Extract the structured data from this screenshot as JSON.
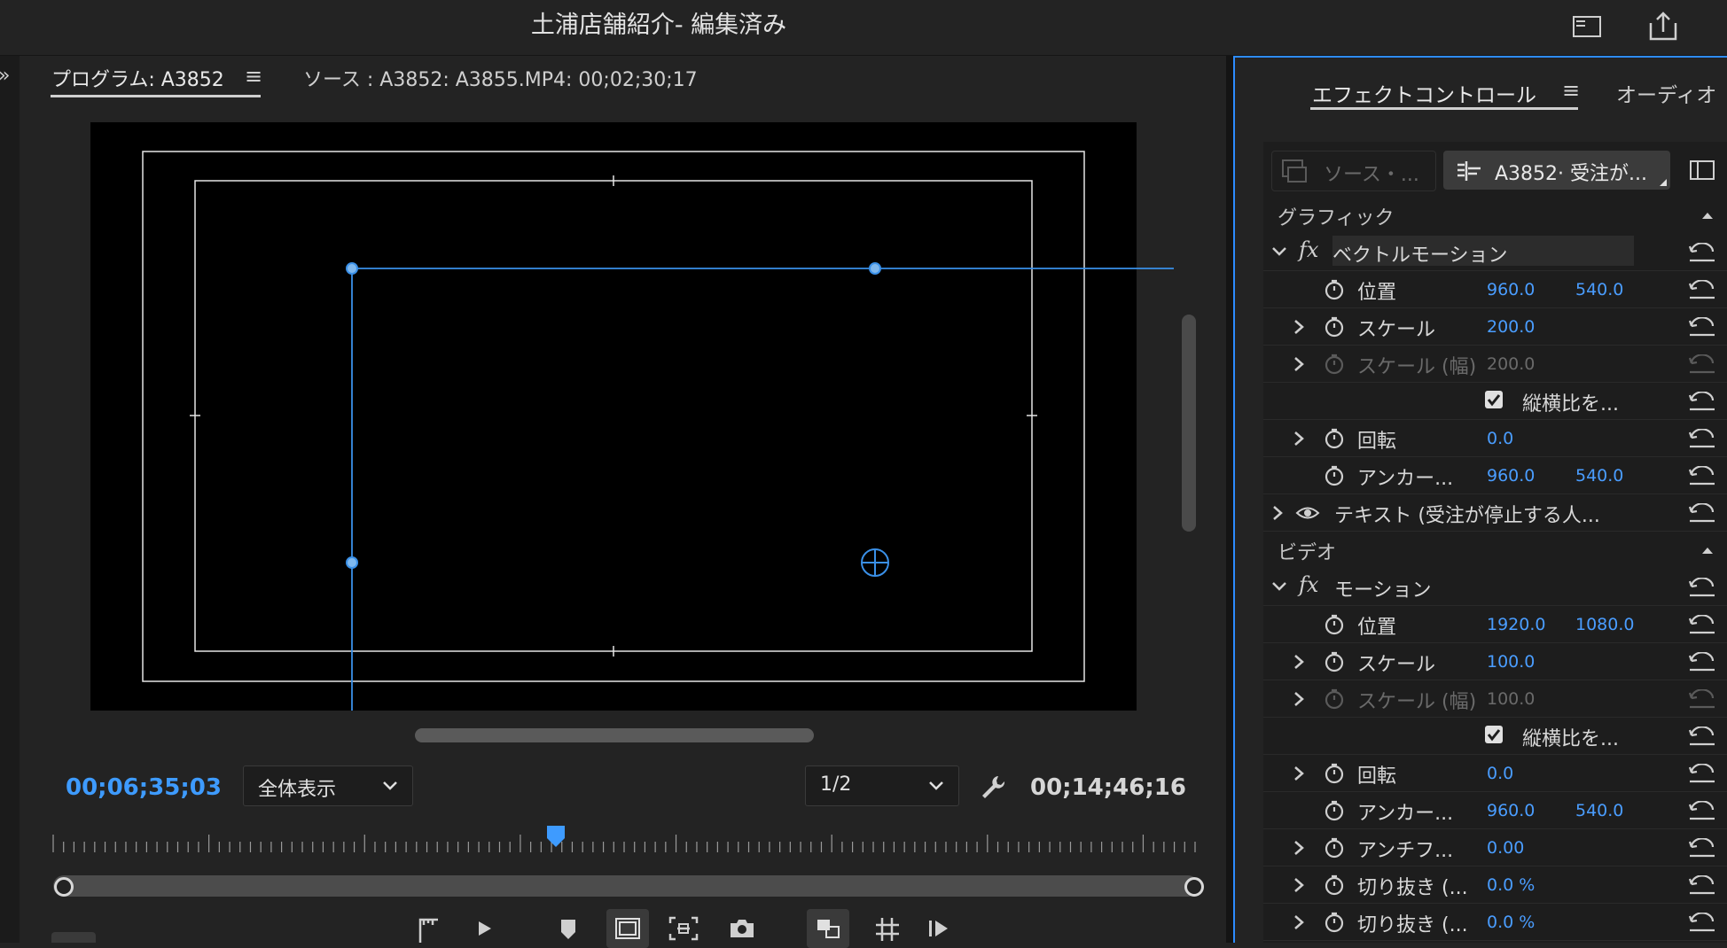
{
  "title_bar": {
    "title": "土浦店舗紹介- 編集済み"
  },
  "program_monitor": {
    "tab_program": "プログラム: A3852",
    "tab_menu": "≡",
    "tab_source": "ソース : A3852: A3855.MP4: 00;02;30;17",
    "timecode_current": "00;06;35;03",
    "zoom_value": "全体表示",
    "resolution_value": "1/2",
    "timecode_duration": "00;14;46;16",
    "playhead_position": 0.44
  },
  "effect_controls": {
    "tab_label": "エフェクトコントロール",
    "tab_menu": "≡",
    "audio_tab": "オーディオ",
    "source_pill": "ソース・...",
    "clip_pill": "A3852· 受注が...",
    "graphics_section": "グラフィック",
    "vector_motion": {
      "label": "ベクトルモーション",
      "position_label": "位置",
      "position_x": "960.0",
      "position_y": "540.0",
      "scale_label": "スケール",
      "scale_value": "200.0",
      "scale_width_label": "スケール (幅)",
      "scale_width_value": "200.0",
      "uniform_label": "縦横比を...",
      "rotation_label": "回転",
      "rotation_value": "0.0",
      "anchor_label": "アンカー...",
      "anchor_x": "960.0",
      "anchor_y": "540.0"
    },
    "text_layer": "テキスト (受注が停止する人...",
    "video_section": "ビデオ",
    "motion": {
      "label": "モーション",
      "position_label": "位置",
      "position_x": "1920.0",
      "position_y": "1080.0",
      "scale_label": "スケール",
      "scale_value": "100.0",
      "scale_width_label": "スケール (幅)",
      "scale_width_value": "100.0",
      "uniform_label": "縦横比を...",
      "rotation_label": "回転",
      "rotation_value": "0.0",
      "anchor_label": "アンカー...",
      "anchor_x": "960.0",
      "anchor_y": "540.0",
      "antiflicker_label": "アンチフ...",
      "antiflicker_value": "0.00",
      "crop1_label": "切り抜き (...",
      "crop1_value": "0.0 %",
      "crop2_label": "切り抜き (...",
      "crop2_value": "0.0 %"
    }
  },
  "colors": {
    "accent": "#2d8cff",
    "value_blue": "#4a9dff",
    "background": "#232323"
  }
}
